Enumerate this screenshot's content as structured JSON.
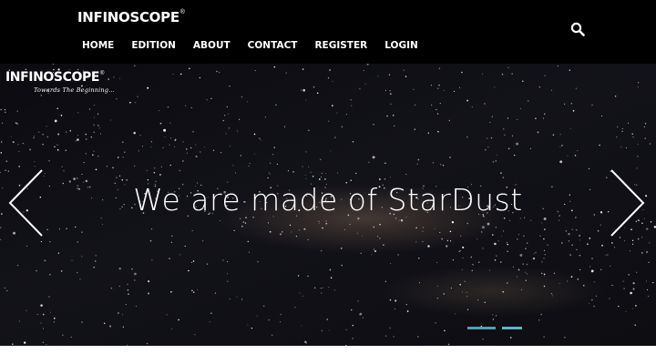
{
  "header": {
    "brand": "INFINOSCOPE",
    "registered_mark": "®",
    "nav": [
      {
        "label": "HOME"
      },
      {
        "label": "EDITION"
      },
      {
        "label": "ABOUT"
      },
      {
        "label": "CONTACT"
      },
      {
        "label": "REGISTER"
      },
      {
        "label": "LOGIN"
      }
    ],
    "search_icon": "search-icon"
  },
  "hero": {
    "logo_text": "INFINOSCOPE",
    "logo_mark": "®",
    "tagline": "Towards The Beginning...",
    "headline": "We are made of StarDust",
    "prev_icon": "chevron-left-icon",
    "next_icon": "chevron-right-icon",
    "slide_count": 2,
    "active_slide": 1
  },
  "colors": {
    "header_bg": "#000000",
    "text": "#ffffff",
    "indicator": "#4aa3b5"
  }
}
